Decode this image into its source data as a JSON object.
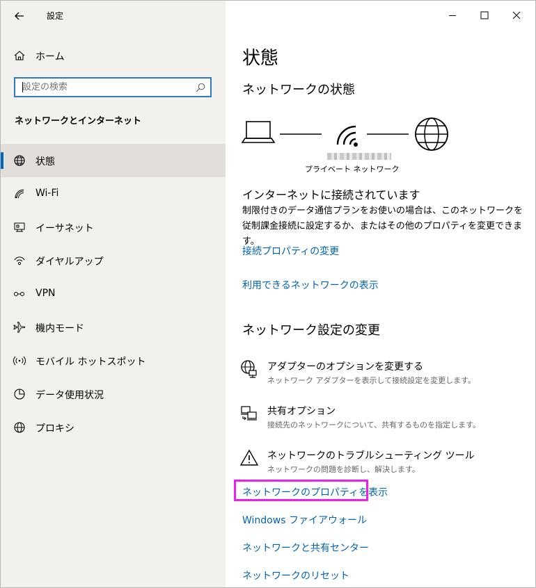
{
  "app": {
    "title": "設定"
  },
  "sidebar": {
    "home_label": "ホーム",
    "search_placeholder": "設定の検索",
    "section_title": "ネットワークとインターネット",
    "items": [
      {
        "label": "状態",
        "icon": "globe-network-icon"
      },
      {
        "label": "Wi-Fi",
        "icon": "wifi-icon"
      },
      {
        "label": "イーサネット",
        "icon": "ethernet-icon"
      },
      {
        "label": "ダイヤルアップ",
        "icon": "dialup-icon"
      },
      {
        "label": "VPN",
        "icon": "vpn-icon"
      },
      {
        "label": "機内モード",
        "icon": "airplane-icon"
      },
      {
        "label": "モバイル ホットスポット",
        "icon": "hotspot-icon"
      },
      {
        "label": "データ使用状況",
        "icon": "data-usage-icon"
      },
      {
        "label": "プロキシ",
        "icon": "proxy-globe-icon"
      }
    ]
  },
  "main": {
    "title": "状態",
    "network_status_heading": "ネットワークの状態",
    "network_name_label": "プライベート ネットワーク",
    "status_title": "インターネットに接続されています",
    "status_desc": "制限付きのデータ通信プランをお使いの場合は、このネットワークを従制課金接続に設定するか、またはその他のプロパティを変更できます。",
    "link_change_properties": "接続プロパティの変更",
    "link_available_networks": "利用できるネットワークの表示",
    "change_settings_heading": "ネットワーク設定の変更",
    "settings": [
      {
        "title": "アダプターのオプションを変更する",
        "desc": "ネットワーク アダプターを表示して接続設定を変更します。",
        "icon": "adapter-icon"
      },
      {
        "title": "共有オプション",
        "desc": "接続先のネットワークについて、共有するものを指定します。",
        "icon": "sharing-icon"
      },
      {
        "title": "ネットワークのトラブルシューティング ツール",
        "desc": "ネットワークの問題を診断し、解決します。",
        "icon": "warning-icon"
      }
    ],
    "link_view_properties": "ネットワークのプロパティを表示",
    "link_firewall": "Windows ファイアウォール",
    "link_sharing_center": "ネットワークと共有センター",
    "link_reset": "ネットワークのリセット"
  },
  "colors": {
    "accent": "#0063b1",
    "highlight": "#f01df0",
    "sidebar_bg": "#f3f1ed",
    "active_bar": "#0067c0"
  }
}
